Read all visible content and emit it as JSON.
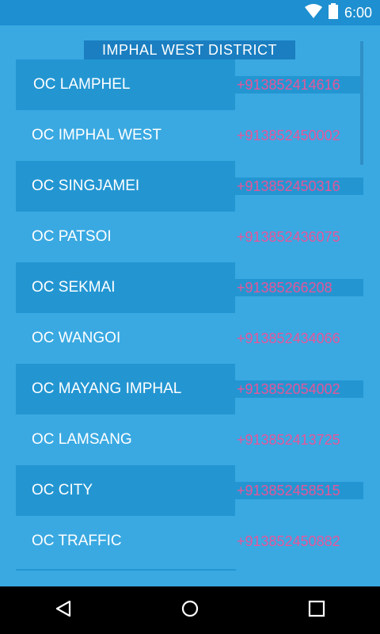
{
  "status_bar": {
    "time": "6:00",
    "icons": [
      "wifi-icon",
      "battery-icon"
    ]
  },
  "header": {
    "district_title": "IMPHAL WEST DISTRICT"
  },
  "stations": [
    {
      "name": "OC LAMPHEL",
      "phone": "+913852414616"
    },
    {
      "name": "OC IMPHAL WEST",
      "phone": "+913852450002"
    },
    {
      "name": "OC SINGJAMEI",
      "phone": "+913852450316"
    },
    {
      "name": "OC PATSOI",
      "phone": "+913852436075"
    },
    {
      "name": "OC SEKMAI",
      "phone": "+91385266208"
    },
    {
      "name": "OC WANGOI",
      "phone": "+913852434066"
    },
    {
      "name": "OC MAYANG IMPHAL",
      "phone": "+913852054002"
    },
    {
      "name": "OC LAMSANG",
      "phone": "+913852413725"
    },
    {
      "name": "OC CITY",
      "phone": "+913852458515"
    },
    {
      "name": "OC TRAFFIC",
      "phone": "+913852450882"
    }
  ],
  "nav_bar": {
    "buttons": [
      "back-icon",
      "home-icon",
      "recents-icon"
    ]
  },
  "colors": {
    "background": "#3aa9e2",
    "dark_row": "#2396d2",
    "phone_text": "#e5569a",
    "title_bg": "#1a7ec0"
  }
}
